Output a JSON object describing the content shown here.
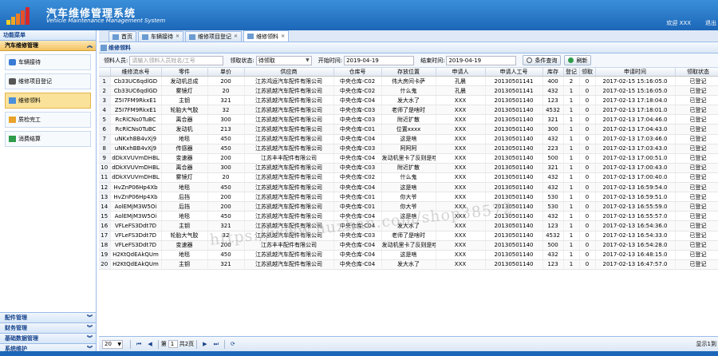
{
  "header": {
    "title": "汽车维修管理系统",
    "subtitle": "Vehicle Maintenance Management System",
    "welcome": "欢迎 XXX",
    "logout": "退出"
  },
  "sidebar": {
    "head": "功能菜单",
    "section": "汽车维修管理",
    "items": [
      {
        "label": "车辆接待"
      },
      {
        "label": "维修项目登记"
      },
      {
        "label": "维修领料"
      },
      {
        "label": "质检完工"
      },
      {
        "label": "消费结算"
      }
    ],
    "groups": [
      "配件管理",
      "财务管理",
      "基础数据管理",
      "系统维护"
    ]
  },
  "tabs": [
    {
      "label": "首页",
      "closable": false
    },
    {
      "label": "车辆接待",
      "closable": true
    },
    {
      "label": "维修项目登记",
      "closable": true
    },
    {
      "label": "维修领料",
      "closable": true
    }
  ],
  "panel": {
    "title": "维修领料"
  },
  "toolbar": {
    "picker_label": "领料人员:",
    "picker_placeholder": "请输入领料人员姓名/工号",
    "status_label": "领取状态:",
    "status_value": "待领取",
    "start_label": "开始时间:",
    "start_value": "2019-04-19",
    "end_label": "结束时间:",
    "end_value": "2019-04-19",
    "search_btn": "条件查询",
    "refresh_btn": "刷新"
  },
  "columns": [
    "",
    "维修流水号",
    "零件",
    "单价",
    "供应商",
    "仓库号",
    "存放位置",
    "申请人",
    "申请人工号",
    "库存",
    "登记",
    "领取",
    "申请时间",
    "领取状态",
    ""
  ],
  "rows": [
    [
      "1",
      "Cb33UC6qdlGD",
      "发动机总成",
      "200",
      "江苏鸿运汽车配件有限公司",
      "中央仓库-C02",
      "伟大房间卡萨",
      "孔晨",
      "20130501141",
      "400",
      "2",
      "0",
      "2017-02-15 15:16:05.0",
      "已登记"
    ],
    [
      "2",
      "Cb33UC6qdlGD",
      "雾镜灯",
      "20",
      "江苏凯越汽车配件有限公司",
      "中央仓库-C02",
      "什么鬼",
      "孔晨",
      "20130501141",
      "432",
      "1",
      "0",
      "2017-02-15 15:16:05.0",
      "已登记"
    ],
    [
      "3",
      "Z5I7FM9RkxE1",
      "主钥",
      "321",
      "江苏凯越汽车配件有限公司",
      "中央仓库-C04",
      "发大水了",
      "XXX",
      "20130501140",
      "123",
      "1",
      "0",
      "2017-02-13 17:18:04.0",
      "已登记"
    ],
    [
      "4",
      "Z5I7FM9RkxE1",
      "轮胎大气胶",
      "32",
      "江苏凯越汽车配件有限公司",
      "中央仓库-C03",
      "老师了是啥时",
      "XXX",
      "20130501140",
      "4532",
      "1",
      "0",
      "2017-02-13 17:18:01.0",
      "已登记"
    ],
    [
      "5",
      "RcRlCNs0TuBC",
      "离合器",
      "300",
      "江苏凯越汽车配件有限公司",
      "中央仓库-C03",
      "附近扩散",
      "XXX",
      "20130501140",
      "321",
      "1",
      "0",
      "2017-02-13 17:04:46.0",
      "已登记"
    ],
    [
      "6",
      "RcRlCNs0TuBC",
      "发动机",
      "213",
      "江苏凯越汽车配件有限公司",
      "中央仓库-C01",
      "位置xxxx",
      "XXX",
      "20130501140",
      "300",
      "1",
      "0",
      "2017-02-13 17:04:43.0",
      "已登记"
    ],
    [
      "7",
      "uNKxhBB4vXj9",
      "地毯",
      "450",
      "江苏凯越汽车配件有限公司",
      "中央仓库-C04",
      "这是啥",
      "XXX",
      "20130501140",
      "432",
      "1",
      "0",
      "2017-02-13 17:03:46.0",
      "已登记"
    ],
    [
      "8",
      "uNKxhBB4vXj9",
      "传感器",
      "450",
      "江苏凯越汽车配件有限公司",
      "中央仓库-C03",
      "阿阿阿",
      "XXX",
      "20130501140",
      "223",
      "1",
      "0",
      "2017-02-13 17:03:43.0",
      "已登记"
    ],
    [
      "9",
      "dDkXVUVmDHBL",
      "变速器",
      "200",
      "江苏丰丰配件有限公司",
      "中央仓库-C04",
      "发动机里卡了反则是哇",
      "XXX",
      "20130501140",
      "500",
      "1",
      "0",
      "2017-02-13 17:00:51.0",
      "已登记"
    ],
    [
      "10",
      "dDkXVUVmDHBL",
      "离合器",
      "300",
      "江苏凯越汽车配件有限公司",
      "中央仓库-C03",
      "附近扩散",
      "XXX",
      "20130501140",
      "321",
      "1",
      "0",
      "2017-02-13 17:00:43.0",
      "已登记"
    ],
    [
      "11",
      "dDkXVUVmDHBL",
      "雾镜灯",
      "20",
      "江苏凯越汽车配件有限公司",
      "中央仓库-C02",
      "什么鬼",
      "XXX",
      "20130501140",
      "432",
      "1",
      "0",
      "2017-02-13 17:00:40.0",
      "已登记"
    ],
    [
      "12",
      "HvZnP06Hp4Xb",
      "地毯",
      "450",
      "江苏凯越汽车配件有限公司",
      "中央仓库-C04",
      "这是啥",
      "XXX",
      "20130501140",
      "432",
      "1",
      "0",
      "2017-02-13 16:59:54.0",
      "已登记"
    ],
    [
      "13",
      "HvZnP06Hp4Xb",
      "后挡",
      "200",
      "江苏凯越汽车配件有限公司",
      "中央仓库-C01",
      "你大爷",
      "XXX",
      "20130501140",
      "530",
      "1",
      "0",
      "2017-02-13 16:59:51.0",
      "已登记"
    ],
    [
      "14",
      "AolEMjM3W5Oi",
      "后挡",
      "200",
      "江苏凯越汽车配件有限公司",
      "中央仓库-C01",
      "你大爷",
      "XXX",
      "20130501140",
      "530",
      "1",
      "0",
      "2017-02-13 16:55:59.0",
      "已登记"
    ],
    [
      "15",
      "AolEMjM3W5Oi",
      "地毯",
      "450",
      "江苏凯越汽车配件有限公司",
      "中央仓库-C04",
      "这是啥",
      "XXX",
      "20130501140",
      "432",
      "1",
      "0",
      "2017-02-13 16:55:57.0",
      "已登记"
    ],
    [
      "16",
      "VFLeFS3Ddt7D",
      "主钥",
      "321",
      "江苏凯越汽车配件有限公司",
      "中央仓库-C04",
      "发大水了",
      "XXX",
      "20130501140",
      "123",
      "1",
      "0",
      "2017-02-13 16:54:36.0",
      "已登记"
    ],
    [
      "17",
      "VFLeFS3Ddt7D",
      "轮胎大气胶",
      "32",
      "江苏凯越汽车配件有限公司",
      "中央仓库-C03",
      "老师了是啥时",
      "XXX",
      "20130501140",
      "4532",
      "1",
      "0",
      "2017-02-13 16:54:33.0",
      "已登记"
    ],
    [
      "18",
      "VFLeFS3Ddt7D",
      "变速器",
      "200",
      "江苏丰丰配件有限公司",
      "中央仓库-C04",
      "发动机里卡了反则是哇",
      "XXX",
      "20130501140",
      "500",
      "1",
      "0",
      "2017-02-13 16:54:28.0",
      "已登记"
    ],
    [
      "19",
      "H2KtQdEAkQUm",
      "地毯",
      "450",
      "江苏凯越汽车配件有限公司",
      "中央仓库-C04",
      "这是啥",
      "XXX",
      "20130501140",
      "432",
      "1",
      "0",
      "2017-02-13 16:48:15.0",
      "已登记"
    ],
    [
      "20",
      "H2KtQdEAkQUm",
      "主钥",
      "321",
      "江苏凯越汽车配件有限公司",
      "中央仓库-C04",
      "发大水了",
      "XXX",
      "20130501140",
      "123",
      "1",
      "0",
      "2017-02-13 16:47:57.0",
      "已登记"
    ]
  ],
  "pager": {
    "page_size": "20",
    "page_prefix": "第",
    "page_value": "1",
    "page_total": "共2页",
    "info": "显示1到"
  },
  "watermark": "https://www.huzhan.com/shop38572",
  "colors": {
    "header": "#1c66b8",
    "accent": "#f4c35f",
    "check": "#22b14c"
  }
}
